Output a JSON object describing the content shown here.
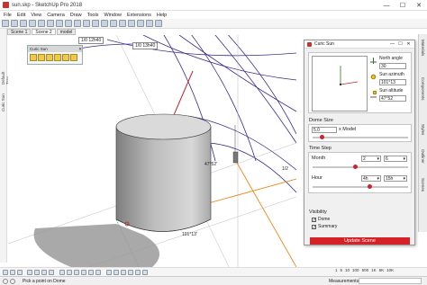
{
  "window": {
    "title": "sun.skp - SketchUp Pro 2018",
    "minimize": "—",
    "maximize": "☐",
    "close": "✕"
  },
  "menu": [
    "File",
    "Edit",
    "View",
    "Camera",
    "Draw",
    "Tools",
    "Window",
    "Extensions",
    "Help"
  ],
  "scenes": [
    "Scene 1",
    "Scene 2",
    "model"
  ],
  "left_tool_labels": [
    "Default Tray",
    "Curic Sun"
  ],
  "curic_toolbar": {
    "title": "Curic Sun",
    "close": "✕"
  },
  "viewport": {
    "measure_top_left": "1/0  12h40",
    "measure_top_right": "1/0  13h40",
    "angle_label": "47°52'",
    "azimuth_label": "101°13'",
    "fraction_label": "1/2"
  },
  "right_tabs": [
    "Materials",
    "Components",
    "Styles",
    "Outliner",
    "Scenes"
  ],
  "dialog": {
    "title": "Curic Sun",
    "minimize": "—",
    "maximize": "☐",
    "close": "✕",
    "north_angle_label": "North angle",
    "north_angle_value": "30",
    "sun_azimuth_label": "Sun azimuth",
    "sun_azimuth_value": "101°13",
    "sun_altitude_label": "Sun altitude",
    "sun_altitude_value": "47°52",
    "dome_size_label": "Dome Size",
    "dome_size_value": "5.0",
    "dome_size_unit": "x Model",
    "dome_slider_level": 0.1,
    "time_step_label": "Time Step",
    "month_label": "Month",
    "month_step": "2",
    "month_value": "6",
    "month_slider_level": 0.45,
    "hour_label": "Hour",
    "hour_step": "4h",
    "hour_value": "15h",
    "hour_slider_level": 0.6,
    "visibility_label": "Visibility",
    "dome_checkbox_label": "Dome",
    "summary_checkbox_label": "Summary",
    "checkbox_mark": "✓",
    "update_button": "Update Scene"
  },
  "status": {
    "hint": "Pick a point on Dome",
    "measurements_label": "Measurements"
  },
  "zoom_levels": [
    "1",
    "5",
    "10",
    "100",
    "500",
    "1K",
    "5K",
    "10K"
  ],
  "colors": {
    "accent_red": "#d42228",
    "dome_lines": "#3b2a8c",
    "orange_line": "#e88a1a",
    "sun_ray": "#c0202a"
  }
}
